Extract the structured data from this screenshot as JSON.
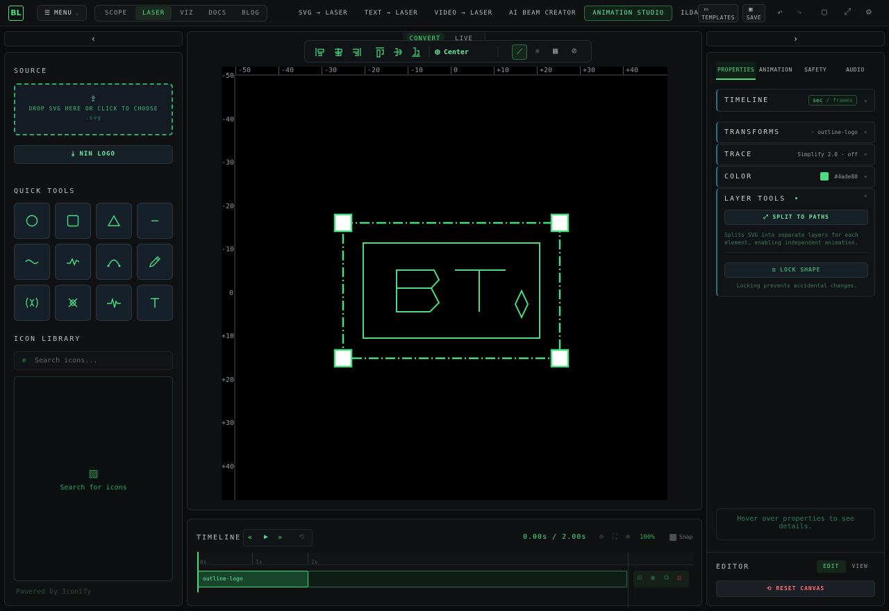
{
  "app": {
    "logo_text": "BL"
  },
  "topbar": {
    "menu_label": "MENU",
    "nav": [
      {
        "label": "SCOPE",
        "active": false
      },
      {
        "label": "LASER",
        "active": true
      },
      {
        "label": "VIZ",
        "active": false
      },
      {
        "label": "DOCS",
        "active": false
      },
      {
        "label": "BLOG",
        "active": false
      }
    ],
    "tabs": [
      {
        "label": "SVG → LASER",
        "active": false
      },
      {
        "label": "TEXT → LASER",
        "active": false
      },
      {
        "label": "VIDEO → LASER",
        "active": false
      },
      {
        "label": "AI BEAM CREATOR",
        "active": false
      },
      {
        "label": "ANIMATION STUDIO",
        "active": true
      },
      {
        "label": "ILDA VIEWER",
        "active": false
      }
    ],
    "templates_label": "TEMPLATES",
    "save_label": "SAVE"
  },
  "left": {
    "source_title": "SOURCE",
    "drop_text": "DROP SVG HERE OR CLICK TO CHOOSE",
    "drop_ext": ".svg",
    "nin_logo_label": "NIN LOGO",
    "quick_tools_title": "QUICK TOOLS",
    "tools": [
      "circle-tool-icon",
      "square-tool-icon",
      "triangle-tool-icon",
      "line-tool-icon",
      "wave-tool-icon",
      "zigzag-tool-icon",
      "arc-tool-icon",
      "pencil-tool-icon",
      "lissajous-tool-icon",
      "star-tool-icon",
      "pulse-tool-icon",
      "text-tool-icon"
    ],
    "icon_library_title": "ICON LIBRARY",
    "search_placeholder": "Search icons...",
    "empty_text": "Search for icons",
    "powered_by": "Powered by Iconify"
  },
  "canvas": {
    "mode_tabs": [
      {
        "label": "CONVERT",
        "active": true
      },
      {
        "label": "LIVE",
        "active": false
      }
    ],
    "center_label": "Center",
    "x_ticks": [
      "-50",
      "-40",
      "-30",
      "-20",
      "-10",
      "0",
      "+10",
      "+20",
      "+30",
      "+40"
    ],
    "y_ticks": [
      "-50",
      "-40",
      "-30",
      "-20",
      "-10",
      "0",
      "+10",
      "+20",
      "+30",
      "+40"
    ],
    "accent": "#4ade80"
  },
  "timeline": {
    "title": "TIMELINE",
    "time_current": "0.00s",
    "time_sep": "/",
    "time_total": "2.00s",
    "zoom": "100%",
    "snap_label": "Snap",
    "marks": [
      "0s",
      "1s",
      "2s"
    ],
    "clip_label": "outline-logo"
  },
  "right": {
    "tabs": [
      {
        "label": "PROPERTIES",
        "active": true
      },
      {
        "label": "ANIMATION",
        "active": false
      },
      {
        "label": "SAFETY",
        "active": false
      },
      {
        "label": "AUDIO",
        "active": false
      }
    ],
    "timeline_label": "TIMELINE",
    "unit_sec": "sec",
    "unit_sep": "/",
    "unit_frames": "frames",
    "transforms_label": "TRANSFORMS",
    "transforms_value": "· outline-logo",
    "trace_label": "TRACE",
    "trace_value": "Simplify 2.0 · off",
    "color_label": "COLOR",
    "color_value": "#4ade80",
    "layer_tools_label": "LAYER TOOLS",
    "split_label": "SPLIT TO PATHS",
    "split_help": "Splits SVG into separate layers for each element, enabling independent animation.",
    "lock_label": "LOCK SHAPE",
    "lock_help": "Locking prevents accidental changes.",
    "hover_help": "Hover over properties to see details.",
    "editor_label": "EDITOR",
    "edit_label": "EDIT",
    "view_label": "VIEW",
    "reset_label": "RESET CANVAS",
    "reset_color": "#f87171"
  }
}
